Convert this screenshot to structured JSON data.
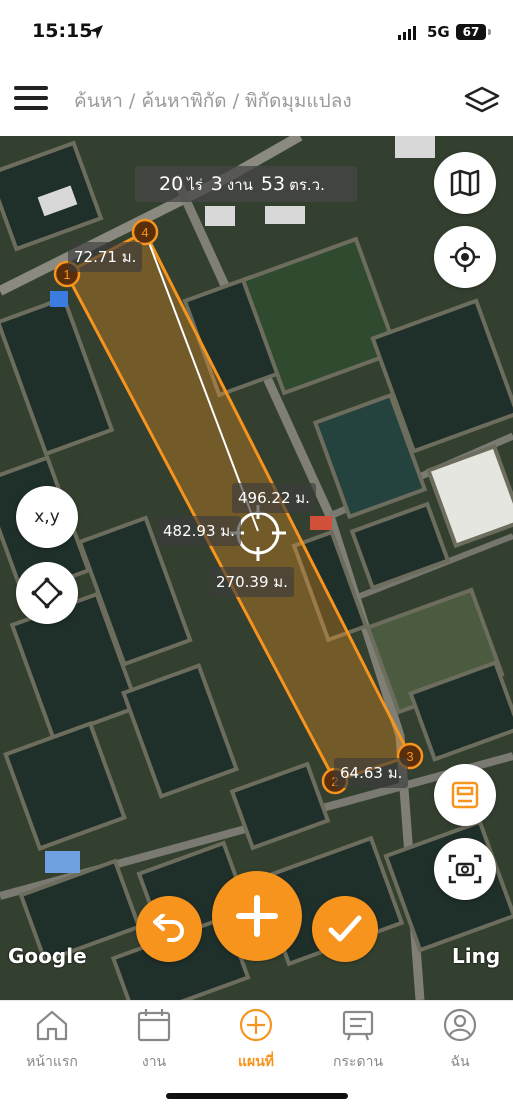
{
  "status_bar": {
    "time": "15:15",
    "network": "5G",
    "battery": "67"
  },
  "header": {
    "breadcrumb": [
      "ค้นหา",
      "ค้นหาพิกัด",
      "พิกัดมุมแปลง"
    ],
    "separator": "/"
  },
  "area": {
    "rai": "20",
    "rai_unit": "ไร่",
    "ngan": "3",
    "ngan_unit": "งาน",
    "wa": "53",
    "wa_unit": "ตร.ว."
  },
  "plot": {
    "points": [
      {
        "label": "1"
      },
      {
        "label": "2"
      },
      {
        "label": "3"
      },
      {
        "label": "4"
      }
    ],
    "edge_labels": {
      "top": "72.71 ม.",
      "bottom": "64.63 ม.",
      "measure_line": "496.22 ม.",
      "left_side": "482.93 ม.",
      "right_side": "270.39 ม."
    },
    "fill_color": "#f7941d",
    "outline_color": "#f7941d"
  },
  "map_controls": {
    "xy_label": "x,y",
    "map_type_icon": "map-icon",
    "locate_icon": "crosshair-icon",
    "draw_icon": "polygon-icon",
    "save_icon": "save-box-icon",
    "capture_icon": "screenshot-icon"
  },
  "actions": {
    "undo_icon": "undo-icon",
    "add_icon": "plus-icon",
    "confirm_icon": "check-icon",
    "color": "#f7941d"
  },
  "attribution": {
    "provider": "Google",
    "credit": "Ling"
  },
  "tabs": [
    {
      "label": "หน้าแรก",
      "icon": "home-icon",
      "active": false
    },
    {
      "label": "งาน",
      "icon": "calendar-icon",
      "active": false
    },
    {
      "label": "แผนที่",
      "icon": "plus-circle-icon",
      "active": true
    },
    {
      "label": "กระดาน",
      "icon": "board-icon",
      "active": false
    },
    {
      "label": "ฉัน",
      "icon": "user-icon",
      "active": false
    }
  ],
  "accent_color": "#f7941d"
}
